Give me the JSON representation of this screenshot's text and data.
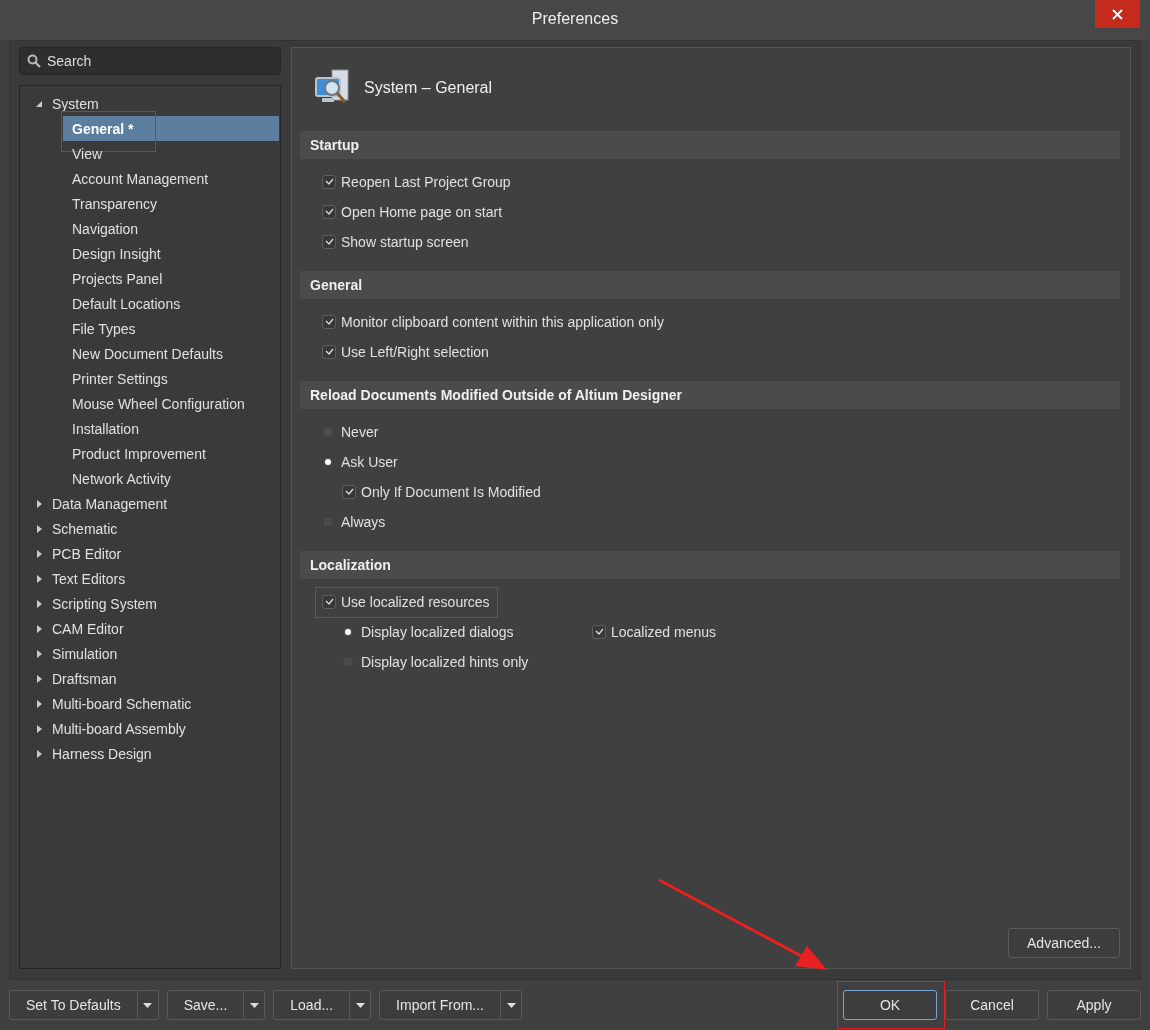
{
  "window": {
    "title": "Preferences"
  },
  "search": {
    "placeholder": "Search"
  },
  "tree": [
    {
      "label": "System",
      "expanded": true,
      "selected": false,
      "children": [
        {
          "label": "General *",
          "selected": true,
          "highlighted": true
        },
        {
          "label": "View",
          "selected": false,
          "highlighted": false
        },
        {
          "label": "Account Management",
          "selected": false,
          "highlighted": false
        },
        {
          "label": "Transparency",
          "selected": false,
          "highlighted": false
        },
        {
          "label": "Navigation",
          "selected": false,
          "highlighted": false
        },
        {
          "label": "Design Insight",
          "selected": false,
          "highlighted": false
        },
        {
          "label": "Projects Panel",
          "selected": false,
          "highlighted": false
        },
        {
          "label": "Default Locations",
          "selected": false,
          "highlighted": false
        },
        {
          "label": "File Types",
          "selected": false,
          "highlighted": false
        },
        {
          "label": "New Document Defaults",
          "selected": false,
          "highlighted": false
        },
        {
          "label": "Printer Settings",
          "selected": false,
          "highlighted": false
        },
        {
          "label": "Mouse Wheel Configuration",
          "selected": false,
          "highlighted": false
        },
        {
          "label": "Installation",
          "selected": false,
          "highlighted": false
        },
        {
          "label": "Product Improvement",
          "selected": false,
          "highlighted": false
        },
        {
          "label": "Network Activity",
          "selected": false,
          "highlighted": false
        }
      ]
    },
    {
      "label": "Data Management",
      "expanded": false,
      "selected": false
    },
    {
      "label": "Schematic",
      "expanded": false,
      "selected": false
    },
    {
      "label": "PCB Editor",
      "expanded": false,
      "selected": false
    },
    {
      "label": "Text Editors",
      "expanded": false,
      "selected": false
    },
    {
      "label": "Scripting System",
      "expanded": false,
      "selected": false
    },
    {
      "label": "CAM Editor",
      "expanded": false,
      "selected": false
    },
    {
      "label": "Simulation",
      "expanded": false,
      "selected": false
    },
    {
      "label": "Draftsman",
      "expanded": false,
      "selected": false
    },
    {
      "label": "Multi-board Schematic",
      "expanded": false,
      "selected": false
    },
    {
      "label": "Multi-board Assembly",
      "expanded": false,
      "selected": false
    },
    {
      "label": "Harness Design",
      "expanded": false,
      "selected": false
    }
  ],
  "page": {
    "title": "System – General",
    "sections": [
      {
        "title": "Startup",
        "options": [
          {
            "kind": "checkbox",
            "label": "Reopen Last Project Group",
            "checked": true,
            "highlighted": false
          },
          {
            "kind": "checkbox",
            "label": "Open Home page on start",
            "checked": true,
            "highlighted": false
          },
          {
            "kind": "checkbox",
            "label": "Show startup screen",
            "checked": true,
            "highlighted": false
          }
        ]
      },
      {
        "title": "General",
        "options": [
          {
            "kind": "checkbox",
            "label": "Monitor clipboard content within this application only",
            "checked": true,
            "highlighted": false
          },
          {
            "kind": "checkbox",
            "label": "Use Left/Right selection",
            "checked": true,
            "highlighted": false
          }
        ]
      },
      {
        "title": "Reload Documents Modified Outside of Altium Designer",
        "options": [
          {
            "kind": "radio",
            "label": "Never",
            "selected": false,
            "highlighted": false
          },
          {
            "kind": "radio",
            "label": "Ask User",
            "selected": true,
            "highlighted": false,
            "children": [
              {
                "kind": "checkbox",
                "label": "Only If Document Is Modified",
                "checked": true,
                "highlighted": false
              }
            ]
          },
          {
            "kind": "radio",
            "label": "Always",
            "selected": false,
            "highlighted": false
          }
        ]
      },
      {
        "title": "Localization",
        "options": [
          {
            "kind": "checkbox",
            "label": "Use localized resources",
            "checked": true,
            "highlighted": true,
            "children": [
              {
                "kind": "radio",
                "label": "Display localized dialogs",
                "selected": true,
                "highlighted": false,
                "side": {
                  "kind": "checkbox",
                  "label": "Localized menus",
                  "checked": true,
                  "highlighted": false
                }
              },
              {
                "kind": "radio",
                "label": "Display localized hints only",
                "selected": false,
                "highlighted": false
              }
            ]
          }
        ]
      }
    ]
  },
  "advanced_button": "Advanced...",
  "footer": {
    "left_buttons": [
      "Set To Defaults",
      "Save...",
      "Load...",
      "Import From..."
    ],
    "right_buttons": [
      {
        "label": "OK",
        "focused": true,
        "highlighted": true
      },
      {
        "label": "Cancel",
        "focused": false,
        "highlighted": false
      },
      {
        "label": "Apply",
        "focused": false,
        "highlighted": false
      }
    ]
  }
}
